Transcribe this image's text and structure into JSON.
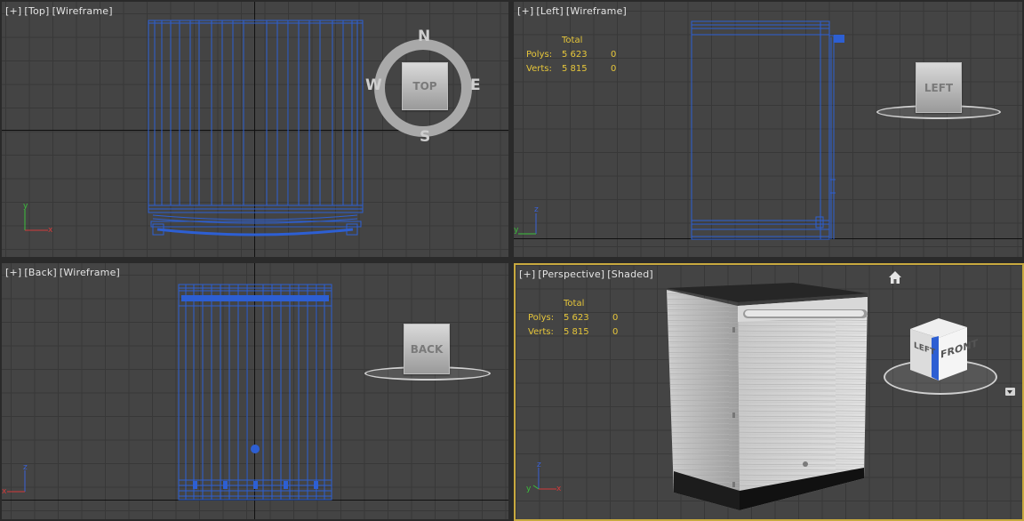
{
  "viewports": {
    "top": {
      "menu": "[+]",
      "view": "[Top]",
      "shading": "[Wireframe]",
      "navigator": {
        "cube": "TOP",
        "north": "N",
        "south": "S",
        "east": "E",
        "west": "W"
      },
      "axes": {
        "vertical": "y",
        "horizontal": "x"
      }
    },
    "left": {
      "menu": "[+]",
      "view": "[Left]",
      "shading": "[Wireframe]",
      "navigator": {
        "cube": "LEFT"
      },
      "axes": {
        "vertical": "z",
        "horizontal": "y"
      }
    },
    "back": {
      "menu": "[+]",
      "view": "[Back]",
      "shading": "[Wireframe]",
      "navigator": {
        "cube": "BACK"
      },
      "axes": {
        "vertical": "z",
        "horizontal": "x"
      }
    },
    "perspective": {
      "menu": "[+]",
      "view": "[Perspective]",
      "shading": "[Shaded]",
      "navigator": {
        "cube_front": "FRONT",
        "cube_left": "LEFT"
      },
      "axes": {
        "vertical": "z",
        "horizontal": "x",
        "depth": "y"
      }
    }
  },
  "stats": {
    "header": "Total",
    "polys_label": "Polys:",
    "polys_value": "5 623",
    "polys_selected": "0",
    "verts_label": "Verts:",
    "verts_value": "5 815",
    "verts_selected": "0"
  },
  "colors": {
    "viewport_bg": "#444444",
    "grid": "#383838",
    "wireframe": "#2d5fd3",
    "active_border": "#c8a93f",
    "stats_text": "#e6c63a"
  }
}
